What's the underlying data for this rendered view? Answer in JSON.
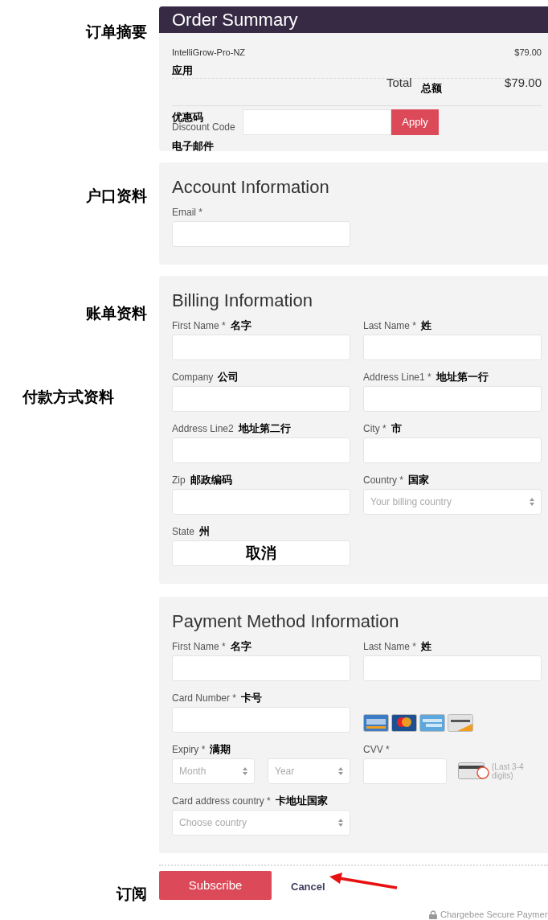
{
  "side_notes": [
    "订单摘要",
    "户口资料",
    "账单资料",
    "付款方式资料",
    "订阅"
  ],
  "order_summary": {
    "title": "Order Summary",
    "items": [
      {
        "name": "IntelliGrow-Pro-NZ",
        "price": "$79.00",
        "note": "应用"
      }
    ],
    "total": {
      "label": "Total",
      "note": "总额",
      "amount": "$79.00"
    },
    "discount": {
      "note": "优惠码",
      "label": "Discount Code",
      "button": "Apply"
    },
    "note_below": "电子邮件"
  },
  "sections": [
    {
      "title": "Account Information",
      "fields": [
        {
          "kind": "input",
          "label": "Email *"
        }
      ]
    },
    {
      "title": "Billing Information",
      "fields": [
        {
          "kind": "input",
          "label": "First Name *",
          "note": "名字"
        },
        {
          "kind": "input",
          "label": "Last Name *",
          "note": "姓"
        },
        {
          "kind": "input",
          "label": "Company",
          "note": "公司"
        },
        {
          "kind": "input",
          "label": "Address Line1 *",
          "note": "地址第一行"
        },
        {
          "kind": "input",
          "label": "Address Line2",
          "note": "地址第二行"
        },
        {
          "kind": "input",
          "label": "City *",
          "note": "市"
        },
        {
          "kind": "input",
          "label": "Zip",
          "note": "邮政编码"
        },
        {
          "kind": "select",
          "label": "Country *",
          "note": "国家",
          "placeholder": "Your billing country"
        },
        {
          "kind": "input",
          "label": "State",
          "note": "州",
          "overlay": "取消"
        }
      ]
    },
    {
      "title": "Payment Method Information",
      "fields": [
        {
          "kind": "input",
          "label": "First Name *",
          "note": "名字"
        },
        {
          "kind": "input",
          "label": "Last Name *",
          "note": "姓"
        },
        {
          "kind": "input",
          "label": "Card Number *",
          "note": "卡号"
        },
        {
          "kind": "cards"
        },
        {
          "kind": "expiry",
          "label": "Expiry *",
          "note": "满期",
          "options": [
            "Month",
            "Year"
          ]
        },
        {
          "kind": "cvv",
          "label": "CVV *",
          "hint": "(Last 3-4 digits)"
        },
        {
          "kind": "select",
          "label": "Card address country *",
          "note": "卡地址国家",
          "placeholder": "Choose country"
        }
      ]
    }
  ],
  "actions": {
    "subscribe": "Subscribe",
    "cancel": "Cancel"
  },
  "footer": "Chargebee Secure Paymen"
}
